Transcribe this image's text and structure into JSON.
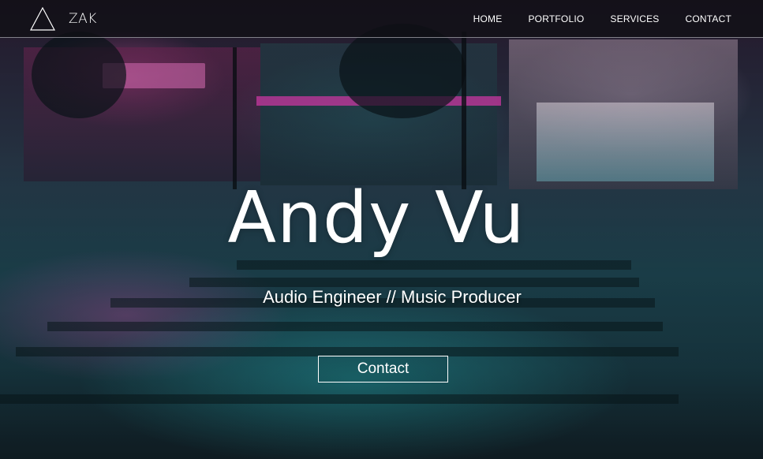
{
  "navbar": {
    "logo_icon": "triangle-outline-icon",
    "brand_name": "ZAK",
    "links": [
      {
        "label": "HOME"
      },
      {
        "label": "PORTFOLIO"
      },
      {
        "label": "SERVICES"
      },
      {
        "label": "CONTACT"
      }
    ]
  },
  "hero": {
    "title": "Andy Vu",
    "subtitle": "Audio Engineer // Music Producer",
    "contact_button": "Contact"
  },
  "colors": {
    "text": "#ffffff",
    "nav_background": "#0f0f14",
    "accent_pink": "#e04fae",
    "accent_teal": "#2cc8cd"
  }
}
